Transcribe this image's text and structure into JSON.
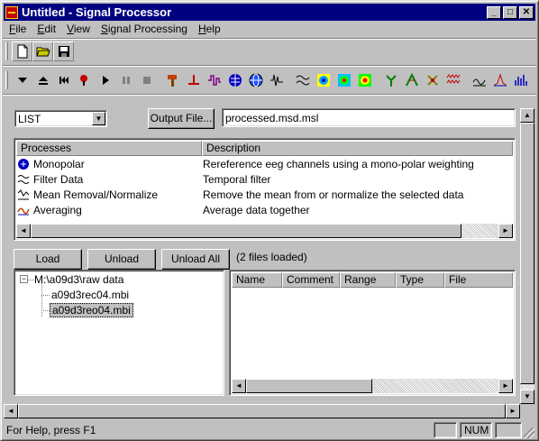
{
  "window": {
    "title": "Untitled - Signal Processor",
    "controls": {
      "minimize": "_",
      "maximize": "□",
      "close": "✕"
    }
  },
  "menubar": {
    "items": [
      {
        "label": "File",
        "accel": "F",
        "rest": "ile"
      },
      {
        "label": "Edit",
        "accel": "E",
        "rest": "dit"
      },
      {
        "label": "View",
        "accel": "V",
        "rest": "iew"
      },
      {
        "label": "Signal Processing",
        "accel": "S",
        "rest": "ignal Processing"
      },
      {
        "label": "Help",
        "accel": "H",
        "rest": "elp"
      }
    ]
  },
  "toolbar1": {
    "icons": [
      "new-file-icon",
      "open-folder-icon",
      "save-icon"
    ]
  },
  "toolbar2": {
    "icons": [
      "play-down-icon",
      "eject-icon",
      "rewind-icon",
      "record-icon",
      "play-icon",
      "pause-icon",
      "stop-icon",
      "hammer-icon",
      "marker-icon",
      "filter-icon",
      "globe-blue-icon",
      "globe-icon",
      "waveform-icon",
      "wave-icon",
      "topo-map-icon",
      "spectrum-map-icon",
      "heat-map-icon",
      "tree-icon",
      "branch-icon",
      "arrow-tree-icon",
      "multi-wave-icon",
      "edit-wave-icon",
      "peak-icon",
      "spectrum-icon"
    ]
  },
  "controls": {
    "list_selector": "LIST",
    "output_button": "Output File...",
    "output_filename": "processed.msd.msl"
  },
  "processes": {
    "columns": [
      "Processes",
      "Description"
    ],
    "rows": [
      {
        "name": "Monopolar",
        "description": "Rereference eeg channels using a mono-polar weighting",
        "icon": "monopolar-icon"
      },
      {
        "name": "Filter Data",
        "description": "Temporal filter",
        "icon": "filter-data-icon"
      },
      {
        "name": "Mean Removal/Normalize",
        "description": "Remove the mean from or normalize the selected data",
        "icon": "mean-removal-icon"
      },
      {
        "name": "Averaging",
        "description": "Average data together",
        "icon": "averaging-icon"
      }
    ]
  },
  "files": {
    "load_button": "Load",
    "unload_button": "Unload",
    "unload_all_button": "Unload All",
    "status": "(2 files loaded)",
    "tree": {
      "root": "M:\\a09d3\\raw data",
      "expander": "−",
      "children": [
        "a09d3rec04.mbi",
        "a09d3reo04.mbi"
      ]
    },
    "columns": [
      "Name",
      "Comment",
      "Range",
      "Type",
      "File"
    ]
  },
  "statusbar": {
    "help_text": "For Help, press F1",
    "num": "NUM"
  }
}
